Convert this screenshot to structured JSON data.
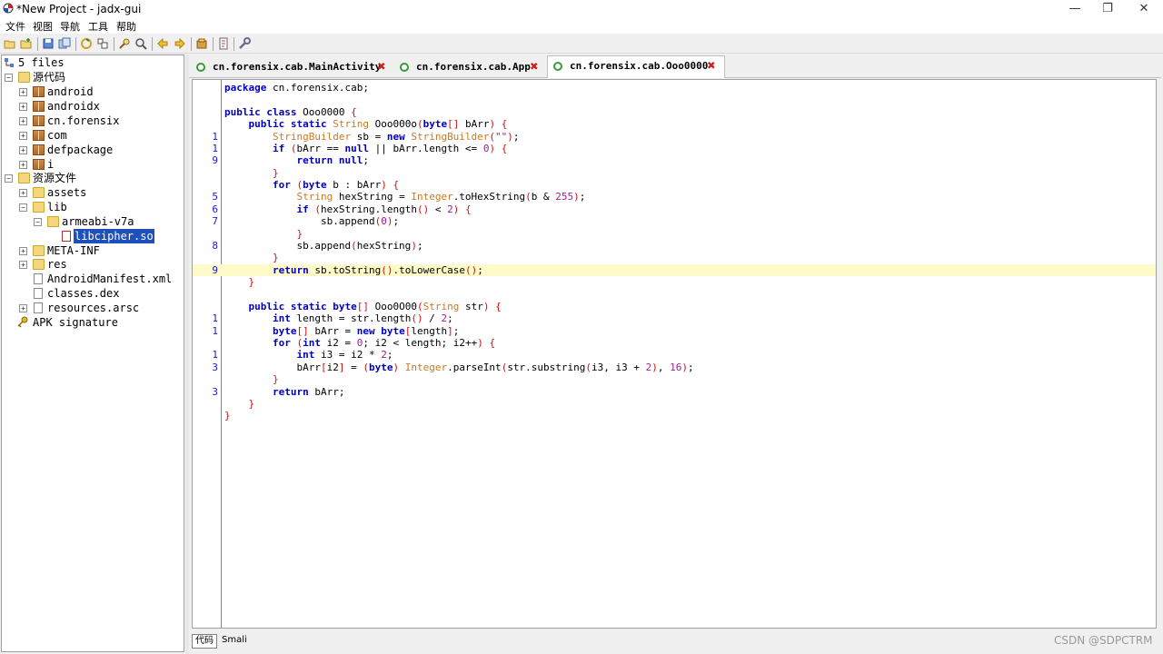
{
  "window": {
    "title": "*New Project - jadx-gui",
    "minimize": "—",
    "maximize": "❐",
    "close": "✕"
  },
  "menu": [
    "文件",
    "视图",
    "导航",
    "工具",
    "帮助"
  ],
  "tree": {
    "root": "5 files",
    "source_label": "源代码",
    "packages": [
      "android",
      "androidx",
      "cn.forensix",
      "com",
      "defpackage",
      "i"
    ],
    "resources_label": "资源文件",
    "assets": "assets",
    "lib": "lib",
    "arch": "armeabi-v7a",
    "selected_file": "libcipher.so",
    "meta_inf": "META-INF",
    "res": "res",
    "manifest": "AndroidManifest.xml",
    "classes": "classes.dex",
    "arsc": "resources.arsc",
    "apk_signature": "APK signature"
  },
  "tabs": [
    {
      "label": "cn.forensix.cab.MainActivity",
      "close": "✖"
    },
    {
      "label": "cn.forensix.cab.App",
      "close": "✖"
    },
    {
      "label": "cn.forensix.cab.Ooo0000",
      "close": "✖"
    }
  ],
  "code": {
    "line_numbers": [
      "",
      "",
      "",
      "",
      "1",
      "1",
      "9",
      "",
      "",
      "5",
      "6",
      "7",
      "",
      "8",
      "",
      "9",
      "",
      "",
      "",
      "1",
      "1",
      "",
      "1",
      "3",
      "",
      "3",
      "",
      ""
    ],
    "line_texts": [
      "package cn.forensix.cab;",
      "",
      "public class Ooo0000 {",
      "    public static String Ooo000o(byte[] bArr) {",
      "        StringBuilder sb = new StringBuilder(\"\");",
      "        if (bArr == null || bArr.length <= 0) {",
      "            return null;",
      "        }",
      "        for (byte b : bArr) {",
      "            String hexString = Integer.toHexString(b & 255);",
      "            if (hexString.length() < 2) {",
      "                sb.append(0);",
      "            }",
      "            sb.append(hexString);",
      "        }",
      "        return sb.toString().toLowerCase();",
      "    }",
      "",
      "    public static byte[] Ooo0O00(String str) {",
      "        int length = str.length() / 2;",
      "        byte[] bArr = new byte[length];",
      "        for (int i2 = 0; i2 < length; i2++) {",
      "            int i3 = i2 * 2;",
      "            bArr[i2] = (byte) Integer.parseInt(str.substring(i3, i3 + 2), 16);",
      "        }",
      "        return bArr;",
      "    }",
      "}"
    ],
    "highlight_line": 15
  },
  "bottom_tabs": [
    "代码",
    "Smali"
  ],
  "watermark": "CSDN @SDPCTRM"
}
